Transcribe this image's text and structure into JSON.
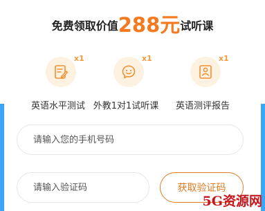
{
  "header": {
    "title_prefix": "免费领取价值",
    "title_highlight": "288元",
    "title_suffix": "试听课"
  },
  "benefits": [
    {
      "icon": "document-pen-icon",
      "badge": "x1",
      "label": "英语水平测试"
    },
    {
      "icon": "chat-smile-icon",
      "badge": "x1",
      "label": "外教1对1试听课"
    },
    {
      "icon": "report-person-icon",
      "badge": "x1",
      "label": "英语测评报告"
    }
  ],
  "form": {
    "phone_placeholder": "请输入您的手机号码",
    "code_placeholder": "请输入验证码",
    "get_code_label": "获取验证码"
  },
  "watermark": "5G资源网",
  "colors": {
    "accent": "#f57a1f",
    "button_border": "#e07a22",
    "icon_bg": "#fdf1e2",
    "side_bar": "#3aa6f5",
    "watermark": "#c4171d"
  }
}
